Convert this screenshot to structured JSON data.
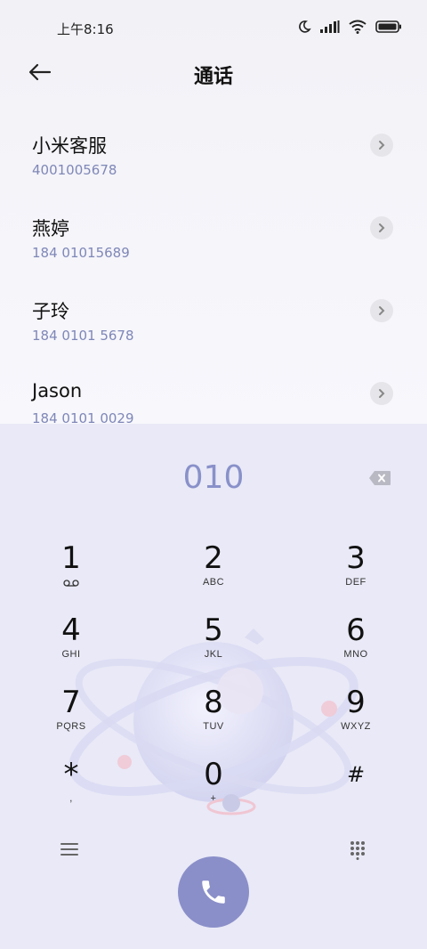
{
  "status_bar": {
    "time": "上午8:16"
  },
  "header": {
    "title": "通话"
  },
  "contacts": [
    {
      "name": "小米客服",
      "number": "4001005678"
    },
    {
      "name": "燕婷",
      "number": "184 01015689"
    },
    {
      "name": "子玲",
      "number": "184 0101 5678"
    },
    {
      "name": "Jason",
      "number": "184 0101 0029"
    }
  ],
  "dialer": {
    "input": "010",
    "keys": [
      {
        "digit": "1",
        "letters": ""
      },
      {
        "digit": "2",
        "letters": "ABC"
      },
      {
        "digit": "3",
        "letters": "DEF"
      },
      {
        "digit": "4",
        "letters": "GHI"
      },
      {
        "digit": "5",
        "letters": "JKL"
      },
      {
        "digit": "6",
        "letters": "MNO"
      },
      {
        "digit": "7",
        "letters": "PQRS"
      },
      {
        "digit": "8",
        "letters": "TUV"
      },
      {
        "digit": "9",
        "letters": "WXYZ"
      },
      {
        "digit": "*",
        "letters": ","
      },
      {
        "digit": "0",
        "letters": "+"
      },
      {
        "digit": "#",
        "letters": ""
      }
    ]
  },
  "icons": {
    "back": "back-arrow-icon",
    "voicemail": "voicemail-icon",
    "backspace": "backspace-icon",
    "menu": "menu-icon",
    "dialpad": "dialpad-icon",
    "call": "phone-icon"
  },
  "colors": {
    "accent": "#8a8fc9",
    "number_text": "#7f87b7",
    "dial_input": "#8991c9",
    "pad_background": "#e9e9f7"
  }
}
